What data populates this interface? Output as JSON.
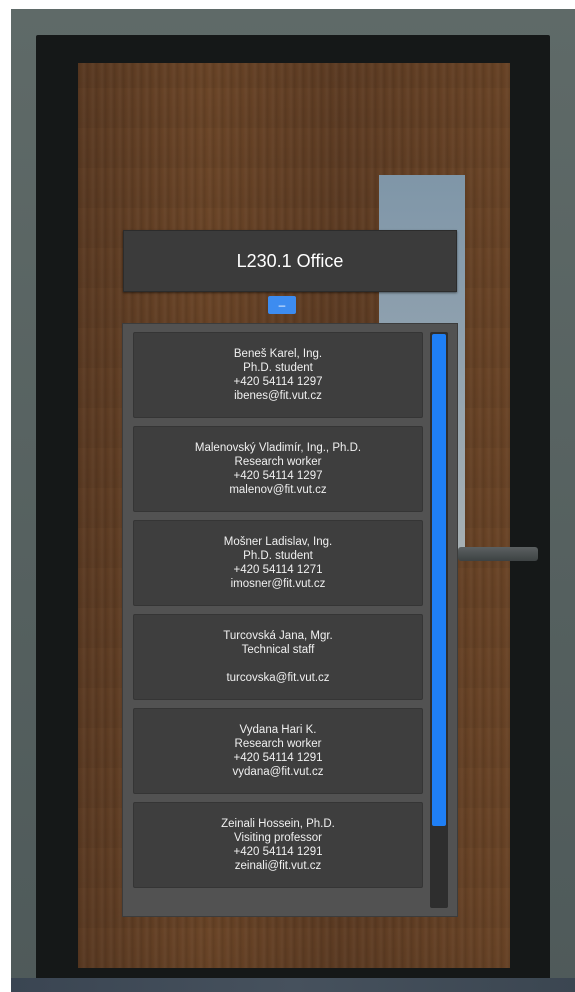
{
  "office": {
    "title": "L230.1 Office"
  },
  "toggle": {
    "label": "–"
  },
  "contacts": [
    {
      "name": "Beneš Karel, Ing.",
      "role": "Ph.D. student",
      "phone": "+420 54114 1297",
      "email": "ibenes@fit.vut.cz"
    },
    {
      "name": "Malenovský Vladimír, Ing., Ph.D.",
      "role": "Research worker",
      "phone": "+420 54114 1297",
      "email": "malenov@fit.vut.cz"
    },
    {
      "name": "Mošner Ladislav, Ing.",
      "role": "Ph.D. student",
      "phone": "+420 54114 1271",
      "email": "imosner@fit.vut.cz"
    },
    {
      "name": "Turcovská Jana, Mgr.",
      "role": "Technical staff",
      "phone": "",
      "email": "turcovska@fit.vut.cz"
    },
    {
      "name": "Vydana Hari K.",
      "role": "Research worker",
      "phone": "+420 54114 1291",
      "email": "vydana@fit.vut.cz"
    },
    {
      "name": "Zeinali Hossein, Ph.D.",
      "role": "Visiting professor",
      "phone": "+420 54114 1291",
      "email": "zeinali@fit.vut.cz"
    }
  ],
  "scroll": {
    "position": 0.86
  },
  "colors": {
    "accent": "#1f7ff5",
    "sign_bg": "#3b3b3b",
    "card_bg": "#3e3e3e",
    "panel_bg": "#525252",
    "wood": "#6b4527"
  }
}
